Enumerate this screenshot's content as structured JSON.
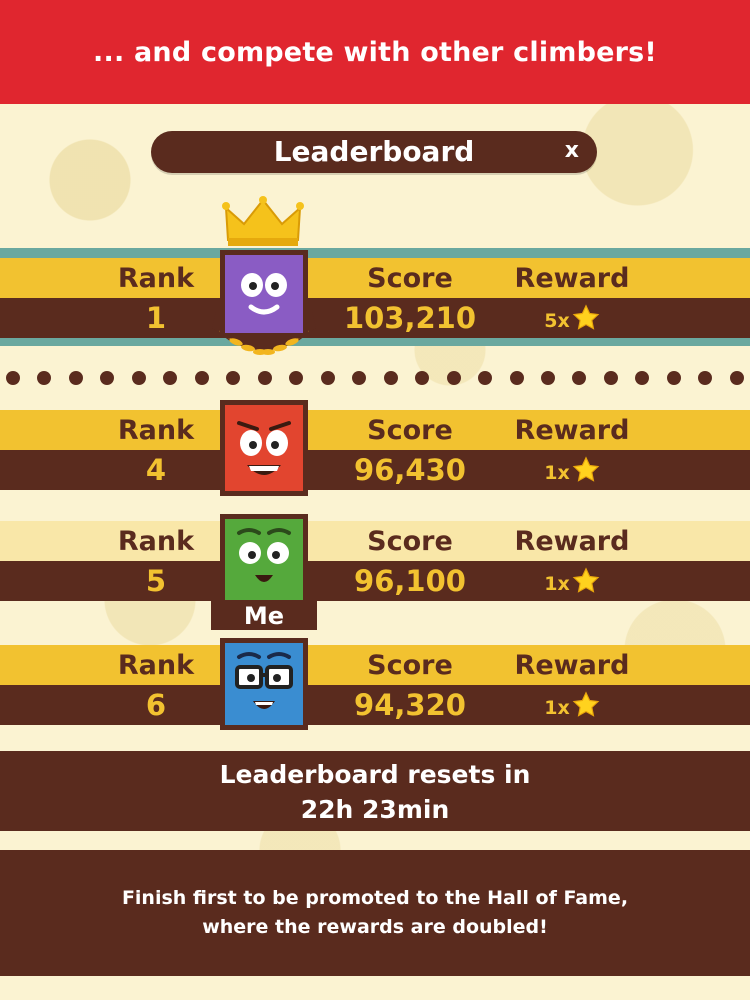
{
  "banner": {
    "text": "... and compete with other climbers!"
  },
  "leaderboard": {
    "title": "Leaderboard",
    "close_label": "x"
  },
  "headers": {
    "rank": "Rank",
    "score": "Score",
    "reward": "Reward"
  },
  "rows": [
    {
      "rank": "1",
      "score": "103,210",
      "reward": "5x",
      "avatar_color": "#8a5cc4",
      "top_band": "#f2c230",
      "icon": "purple-crowned-avatar-icon"
    },
    {
      "rank": "4",
      "score": "96,430",
      "reward": "1x",
      "avatar_color": "#e2452f",
      "top_band": "#f2c230",
      "icon": "red-avatar-icon"
    },
    {
      "rank": "5",
      "score": "96,100",
      "reward": "1x",
      "avatar_color": "#55a93c",
      "top_band": "#f9e7a8",
      "icon": "green-avatar-icon"
    },
    {
      "rank": "6",
      "score": "94,320",
      "reward": "1x",
      "avatar_color": "#3a8dd1",
      "top_band": "#f2c230",
      "icon": "blue-glasses-avatar-icon"
    }
  ],
  "me_label": "Me",
  "reset": {
    "line1": "Leaderboard resets in",
    "line2": "22h 23min"
  },
  "info": {
    "line1": "Finish first to be promoted to the Hall of Fame,",
    "line2": "where  the rewards are doubled!"
  },
  "colors": {
    "brand_red": "#e0262f",
    "brown": "#5a2b1e",
    "gold": "#f2c230",
    "teal": "#6aa89f"
  }
}
